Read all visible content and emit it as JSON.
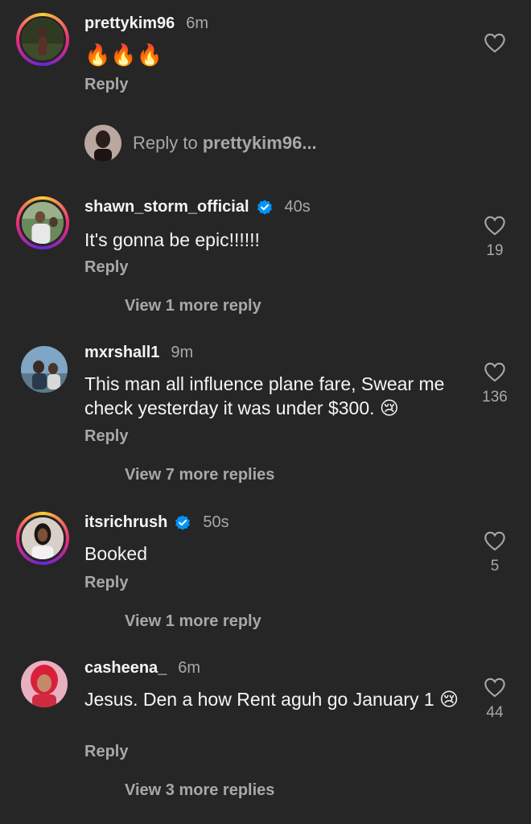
{
  "comments": [
    {
      "username": "prettykim96",
      "time": "6m",
      "text": "🔥🔥🔥",
      "reply": "Reply",
      "likes": ""
    },
    {
      "username": "shawn_storm_official",
      "verified": true,
      "time": "40s",
      "text": "It's gonna be epic!!!!!!",
      "reply": "Reply",
      "likes": "19",
      "view_more": "View 1 more reply"
    },
    {
      "username": "mxrshall1",
      "time": "9m",
      "text": "This man all influence plane fare, Swear me check yesterday it was under $300. 😢",
      "reply": "Reply",
      "likes": "136",
      "view_more": "View 7 more replies"
    },
    {
      "username": "itsrichrush",
      "verified": true,
      "time": "50s",
      "text": "Booked",
      "reply": "Reply",
      "likes": "5",
      "view_more": "View 1 more reply"
    },
    {
      "username": "casheena_",
      "time": "6m",
      "text": "Jesus. Den a how Rent aguh go January 1 😢",
      "reply": "Reply",
      "likes": "44",
      "view_more": "View 3 more replies"
    }
  ],
  "reply_box": {
    "prefix": "Reply to ",
    "target": "prettykim96..."
  },
  "colors": {
    "background": "#262626",
    "secondary_text": "#a8a8a8",
    "verified": "#0095f6"
  }
}
